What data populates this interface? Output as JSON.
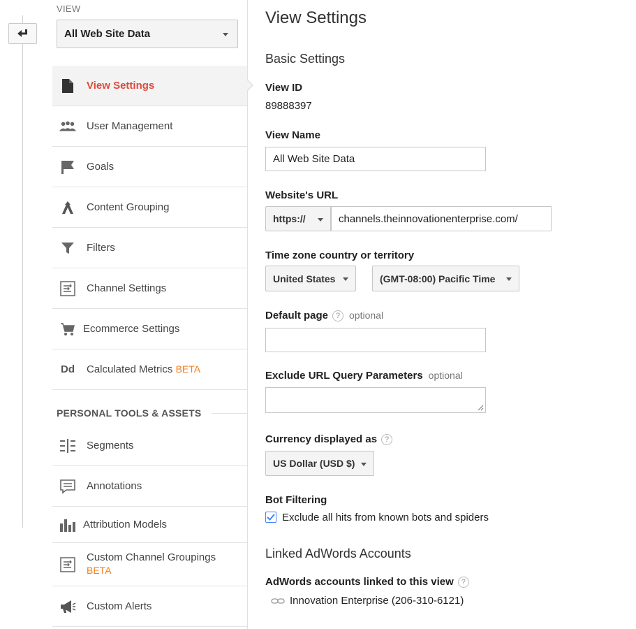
{
  "sidebar": {
    "view_label": "VIEW",
    "view_select": "All Web Site Data",
    "items": [
      {
        "label": "View Settings",
        "icon": "document-icon",
        "active": true
      },
      {
        "label": "User Management",
        "icon": "users-icon"
      },
      {
        "label": "Goals",
        "icon": "flag-icon"
      },
      {
        "label": "Content Grouping",
        "icon": "content-grouping-icon"
      },
      {
        "label": "Filters",
        "icon": "filter-icon"
      },
      {
        "label": "Channel Settings",
        "icon": "channel-settings-icon"
      },
      {
        "label": "Ecommerce Settings",
        "icon": "cart-icon"
      },
      {
        "label": "Calculated Metrics",
        "beta": "BETA",
        "icon": "dd-icon"
      }
    ],
    "section_heading": "PERSONAL TOOLS & ASSETS",
    "personal_items": [
      {
        "label": "Segments",
        "icon": "segments-icon"
      },
      {
        "label": "Annotations",
        "icon": "annotation-icon"
      },
      {
        "label": "Attribution Models",
        "icon": "bar-chart-icon"
      },
      {
        "label": "Custom Channel Groupings",
        "beta": "BETA",
        "icon": "channel-settings-icon"
      },
      {
        "label": "Custom Alerts",
        "icon": "megaphone-icon"
      }
    ]
  },
  "main": {
    "title": "View Settings",
    "basic_settings": "Basic Settings",
    "view_id_label": "View ID",
    "view_id": "89888397",
    "view_name_label": "View Name",
    "view_name": "All Web Site Data",
    "website_url_label": "Website's URL",
    "protocol": "https://",
    "website_url": "channels.theinnovationenterprise.com/",
    "timezone_label": "Time zone country or territory",
    "country": "United States",
    "timezone": "(GMT-08:00) Pacific Time",
    "default_page_label": "Default page",
    "optional": "optional",
    "help_glyph": "?",
    "default_page": "",
    "exclude_label": "Exclude URL Query Parameters",
    "exclude_value": "",
    "currency_label": "Currency displayed as",
    "currency": "US Dollar (USD $)",
    "bot_filtering_label": "Bot Filtering",
    "bot_filtering_text": "Exclude all hits from known bots and spiders",
    "bot_filtering_checked": true,
    "linked_adwords_heading": "Linked AdWords Accounts",
    "adwords_linked_label": "AdWords accounts linked to this view",
    "adwords_account": "Innovation Enterprise (206-310-6121)"
  },
  "colors": {
    "active": "#dd4b39",
    "beta": "#f57f17",
    "checkbox": "#4285f4"
  }
}
